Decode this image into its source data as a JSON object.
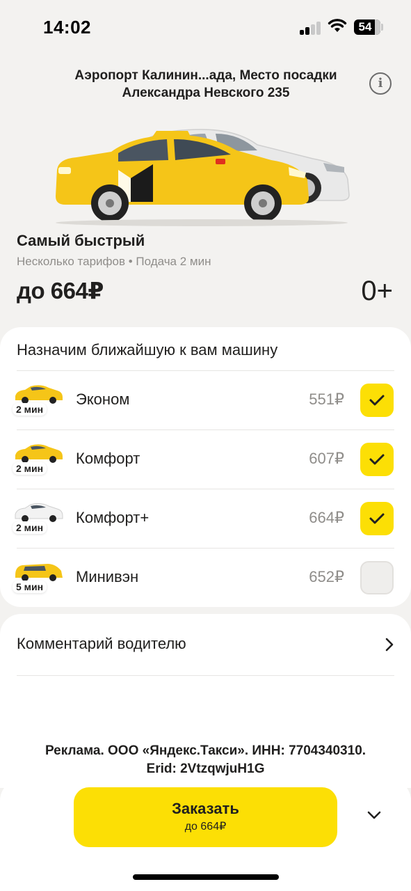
{
  "status_bar": {
    "time": "14:02",
    "battery": "54"
  },
  "header": {
    "address_line1": "Аэропорт Калинин...ада, Место посадки",
    "address_line2": "Александра Невского 235",
    "info_icon": "info-icon"
  },
  "tariff": {
    "title": "Самый быстрый",
    "subtitle": "Несколько тарифов • Подача 2 мин",
    "price": "до 664₽",
    "seats": "0+"
  },
  "options": {
    "title": "Назначим ближайшую к вам машину",
    "items": [
      {
        "name": "Эконом",
        "price": "551₽",
        "eta": "2 мин",
        "checked": true,
        "car_color": "#f5c518"
      },
      {
        "name": "Комфорт",
        "price": "607₽",
        "eta": "2 мин",
        "checked": true,
        "car_color": "#f5c518"
      },
      {
        "name": "Комфорт+",
        "price": "664₽",
        "eta": "2 мин",
        "checked": true,
        "car_color": "#f2f2f2"
      },
      {
        "name": "Минивэн",
        "price": "652₽",
        "eta": "5 мин",
        "checked": false,
        "car_color": "#f5c518"
      }
    ]
  },
  "comment": {
    "label": "Комментарий водителю",
    "chevron_icon": "chevron-right-icon"
  },
  "ad": {
    "line1": "Реклама. ООО «Яндекс.Такси». ИНН: 7704340310.",
    "line2": "Erid: 2VtzqwjuH1G"
  },
  "order": {
    "label": "Заказать",
    "price": "до 664₽",
    "expand_icon": "chevron-down-icon"
  },
  "colors": {
    "accent": "#fcdf05",
    "background": "#f3f2f0",
    "text": "#21201f",
    "muted": "#8f8d8a"
  }
}
